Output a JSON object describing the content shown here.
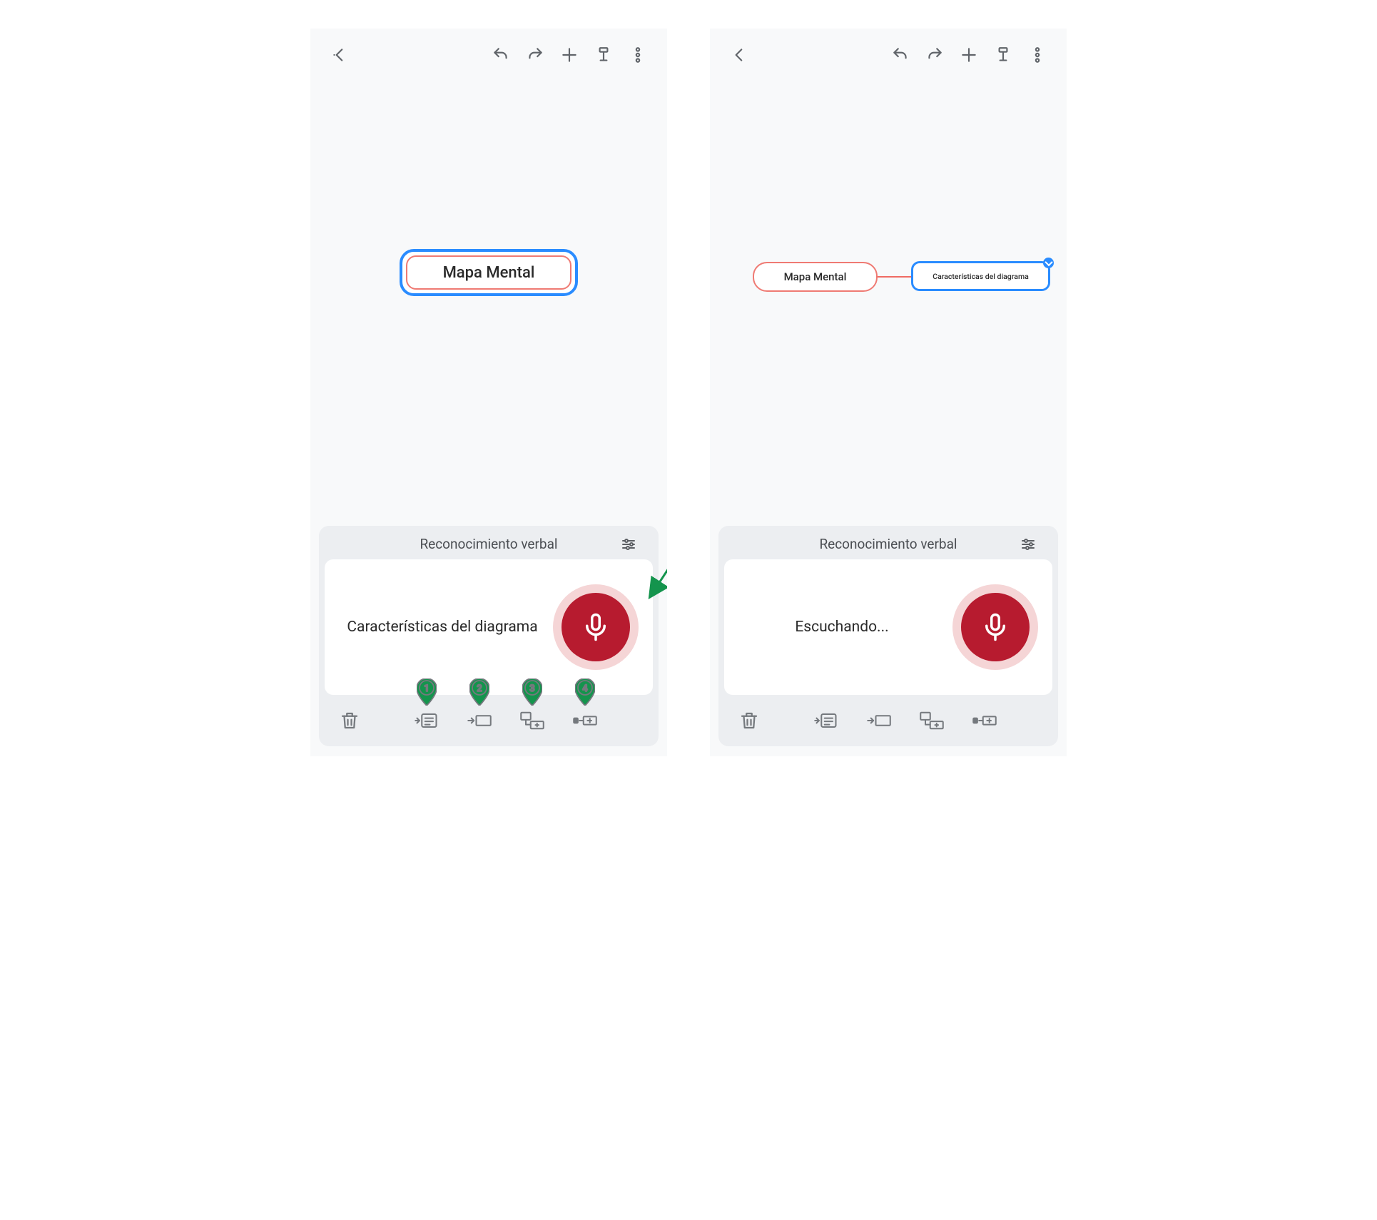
{
  "left": {
    "toolbar": {
      "back": "back",
      "undo": "undo",
      "redo": "redo",
      "add": "add",
      "format": "format",
      "more": "more"
    },
    "node": {
      "title": "Mapa Mental"
    },
    "panel": {
      "title": "Reconocimiento verbal",
      "recognized": "Características del diagrama",
      "foot": {
        "delete": "delete",
        "insert_note": "insert-note",
        "insert_sibling": "insert-sibling",
        "insert_child": "insert-child",
        "insert_floating": "insert-floating"
      },
      "pins": [
        "1",
        "2",
        "3",
        "4"
      ]
    }
  },
  "right": {
    "toolbar": {
      "back": "back",
      "undo": "undo",
      "redo": "redo",
      "add": "add",
      "format": "format",
      "more": "more"
    },
    "node_root": "Mapa Mental",
    "node_child": "Características del diagrama",
    "panel": {
      "title": "Reconocimiento verbal",
      "recognized": "Escuchando...",
      "foot": {
        "delete": "delete",
        "insert_note": "insert-note",
        "insert_sibling": "insert-sibling",
        "insert_child": "insert-child",
        "insert_floating": "insert-floating"
      }
    }
  },
  "colors": {
    "icon": "#61656a",
    "select": "#2a8cff",
    "node_border": "#ef7a73",
    "mic": "#b71b2f",
    "mic_halo": "#f5d5d6",
    "anno": "#14944d"
  }
}
